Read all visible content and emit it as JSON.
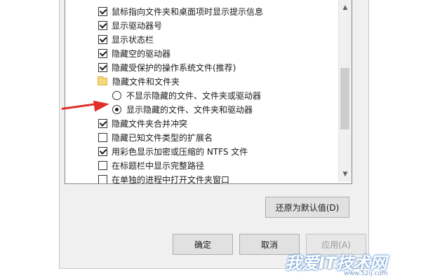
{
  "tree": {
    "items": [
      {
        "type": "checkbox",
        "checked": true,
        "label": "鼠标指向文件夹和桌面项时显示提示信息"
      },
      {
        "type": "checkbox",
        "checked": true,
        "label": "显示驱动器号"
      },
      {
        "type": "checkbox",
        "checked": true,
        "label": "显示状态栏"
      },
      {
        "type": "checkbox",
        "checked": true,
        "label": "隐藏空的驱动器"
      },
      {
        "type": "checkbox",
        "checked": true,
        "label": "隐藏受保护的操作系统文件(推荐)"
      },
      {
        "type": "folder",
        "label": "隐藏文件和文件夹"
      },
      {
        "type": "radio",
        "checked": false,
        "label": "不显示隐藏的文件、文件夹或驱动器"
      },
      {
        "type": "radio",
        "checked": true,
        "label": "显示隐藏的文件、文件夹和驱动器"
      },
      {
        "type": "checkbox",
        "checked": true,
        "label": "隐藏文件夹合并冲突"
      },
      {
        "type": "checkbox",
        "checked": false,
        "label": "隐藏已知文件类型的扩展名"
      },
      {
        "type": "checkbox",
        "checked": true,
        "label": "用彩色显示加密或压缩的 NTFS 文件"
      },
      {
        "type": "checkbox",
        "checked": false,
        "label": "在标题栏中显示完整路径"
      },
      {
        "type": "checkbox",
        "checked": false,
        "label": "在单独的进程中打开文件夹窗口"
      }
    ]
  },
  "scrollbar": {
    "up_icon": "▲",
    "down_icon": "▼"
  },
  "buttons": {
    "restore_defaults": "还原为默认值(D)",
    "ok": "确定",
    "cancel": "取消",
    "apply": "应用(A)"
  },
  "annotation": {
    "color": "#e0302c",
    "icon": "red-arrow"
  },
  "watermark": {
    "text": "我爱IT技术网",
    "url": "www.52ij.com"
  }
}
